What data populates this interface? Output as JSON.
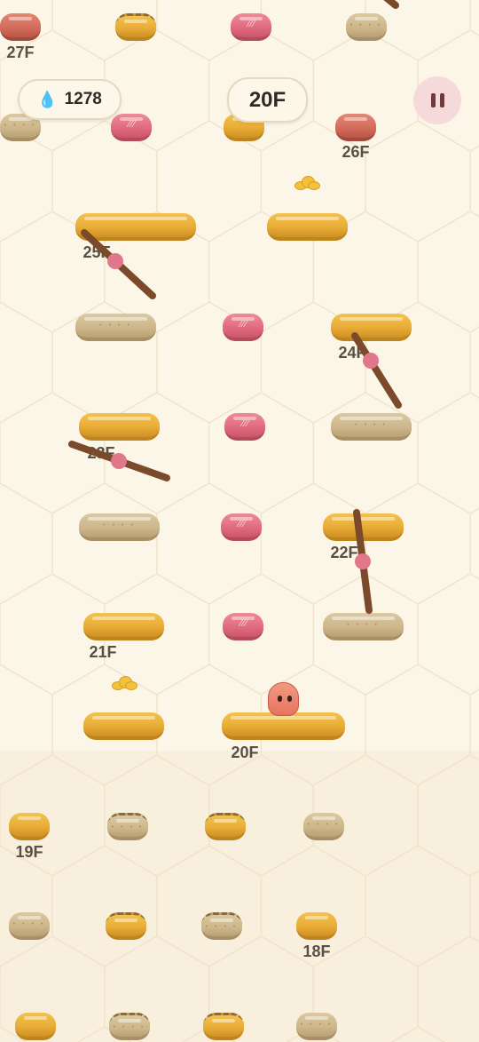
{
  "hud": {
    "coins_icon": "drop-coin-icon",
    "coins": "1278",
    "current_floor": "20F",
    "pause_icon": "pause-icon"
  },
  "floors": [
    {
      "label": "27F"
    },
    {
      "label": "26F"
    },
    {
      "label": "25F"
    },
    {
      "label": "24F"
    },
    {
      "label": "23F"
    },
    {
      "label": "22F"
    },
    {
      "label": "21F"
    },
    {
      "label": "20F"
    },
    {
      "label": "19F"
    },
    {
      "label": "18F"
    }
  ],
  "player": {
    "icon": "blob-player",
    "current_floor": "20F"
  },
  "colors": {
    "background": "#fcf6e8",
    "gold_platform": "#e9ad38",
    "sand_platform": "#cdb68a",
    "pink_platform": "#e06b7e",
    "lever": "#7b4a2a",
    "lever_pivot": "#e0778a",
    "player": "#e5745e",
    "pause_button": "#f6d9db"
  }
}
